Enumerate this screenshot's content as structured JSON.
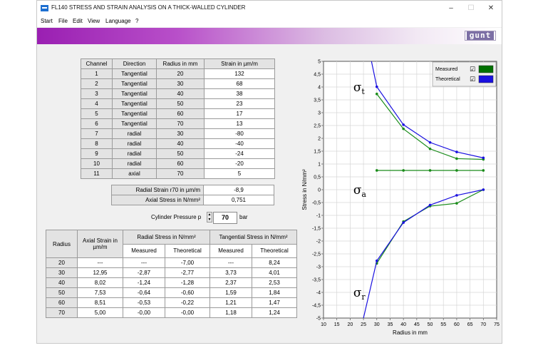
{
  "window": {
    "title": "FL140 STRESS AND STRAIN ANALYSIS ON A THICK-WALLED CYLINDER",
    "minimize": "–",
    "maximize": "☐",
    "close": "✕"
  },
  "menu": [
    "Start",
    "File",
    "Edit",
    "View",
    "Language",
    "?"
  ],
  "logo": "gunt",
  "channels": {
    "headers": [
      "Channel",
      "Direction",
      "Radius in mm",
      "Strain in µm/m"
    ],
    "rows": [
      [
        "1",
        "Tangential",
        "20",
        "132"
      ],
      [
        "2",
        "Tangential",
        "30",
        "68"
      ],
      [
        "3",
        "Tangential",
        "40",
        "38"
      ],
      [
        "4",
        "Tangential",
        "50",
        "23"
      ],
      [
        "5",
        "Tangential",
        "60",
        "17"
      ],
      [
        "6",
        "Tangential",
        "70",
        "13"
      ],
      [
        "7",
        "radial",
        "30",
        "-80"
      ],
      [
        "8",
        "radial",
        "40",
        "-40"
      ],
      [
        "9",
        "radial",
        "50",
        "-24"
      ],
      [
        "10",
        "radial",
        "60",
        "-20"
      ],
      [
        "11",
        "axial",
        "70",
        "5"
      ]
    ]
  },
  "info": [
    {
      "label": "Radial Strain r70 in µm/m",
      "value": "-8,9"
    },
    {
      "label": "Axial Stress in N/mm²",
      "value": "0,751"
    }
  ],
  "pressure": {
    "label": "Cylinder Pressure  p",
    "value": "70",
    "unit": "bar"
  },
  "results": {
    "h_radius": "Radius",
    "h_axial": "Axial Strain in µm/m",
    "h_radial": "Radial Stress in N/mm²",
    "h_tangential": "Tangential Stress in N/mm²",
    "h_measured": "Measured",
    "h_theoretical": "Theoretical",
    "rows": [
      [
        "20",
        "---",
        "---",
        "-7,00",
        "---",
        "8,24"
      ],
      [
        "30",
        "12,95",
        "-2,87",
        "-2,77",
        "3,73",
        "4,01"
      ],
      [
        "40",
        "8,02",
        "-1,24",
        "-1,28",
        "2,37",
        "2,53"
      ],
      [
        "50",
        "7,53",
        "-0,64",
        "-0,60",
        "1,59",
        "1,84"
      ],
      [
        "60",
        "8,51",
        "-0,53",
        "-0,22",
        "1,21",
        "1,47"
      ],
      [
        "70",
        "5,00",
        "-0,00",
        "-0,00",
        "1,18",
        "1,24"
      ]
    ]
  },
  "chart_data": {
    "type": "line",
    "xlabel": "Radius in mm",
    "ylabel": "Stress in N/mm²",
    "xlim": [
      10,
      75
    ],
    "ylim": [
      -5,
      5
    ],
    "xticks": [
      10,
      15,
      20,
      25,
      30,
      35,
      40,
      45,
      50,
      55,
      60,
      65,
      70,
      75
    ],
    "yticks": [
      "-5",
      "-4,5",
      "-4",
      "-3,5",
      "-3",
      "-2,5",
      "-2",
      "-1,5",
      "-1",
      "-0,5",
      "0",
      "0,5",
      "1",
      "1,5",
      "2",
      "2,5",
      "3",
      "3,5",
      "4",
      "4,5",
      "5"
    ],
    "grid": true,
    "legend_position": "top-right",
    "legend": [
      {
        "name": "Measured",
        "checked": "☑",
        "color": "#007000"
      },
      {
        "name": "Theoretical",
        "checked": "☑",
        "color": "#1a10e0"
      }
    ],
    "annotations": [
      {
        "text": "σt",
        "x": 26,
        "y": 4.0
      },
      {
        "text": "σa",
        "x": 26,
        "y": 0.0
      },
      {
        "text": "σr",
        "x": 26,
        "y": -4.0
      }
    ],
    "series": [
      {
        "name": "Measured",
        "color": "#1a8c1a",
        "curves": [
          {
            "x": [
              30,
              40,
              50,
              60,
              70
            ],
            "y": [
              3.73,
              2.37,
              1.59,
              1.21,
              1.18
            ]
          },
          {
            "x": [
              30,
              40,
              50,
              60,
              70
            ],
            "y": [
              0.751,
              0.751,
              0.751,
              0.751,
              0.751
            ]
          },
          {
            "x": [
              30,
              40,
              50,
              60,
              70
            ],
            "y": [
              -2.87,
              -1.24,
              -0.64,
              -0.53,
              0.0
            ]
          }
        ]
      },
      {
        "name": "Theoretical",
        "color": "#1a10e0",
        "curves": [
          {
            "x": [
              28,
              30,
              40,
              50,
              60,
              70
            ],
            "y": [
              5.0,
              4.01,
              2.53,
              1.84,
              1.47,
              1.24
            ],
            "markers": [
              30,
              40,
              50,
              60,
              70
            ]
          },
          {
            "x": [
              25,
              30,
              40,
              50,
              60,
              70
            ],
            "y": [
              -5.0,
              -2.77,
              -1.28,
              -0.6,
              -0.22,
              0.0
            ],
            "markers": [
              30,
              40,
              50,
              60,
              70
            ]
          }
        ]
      }
    ]
  }
}
